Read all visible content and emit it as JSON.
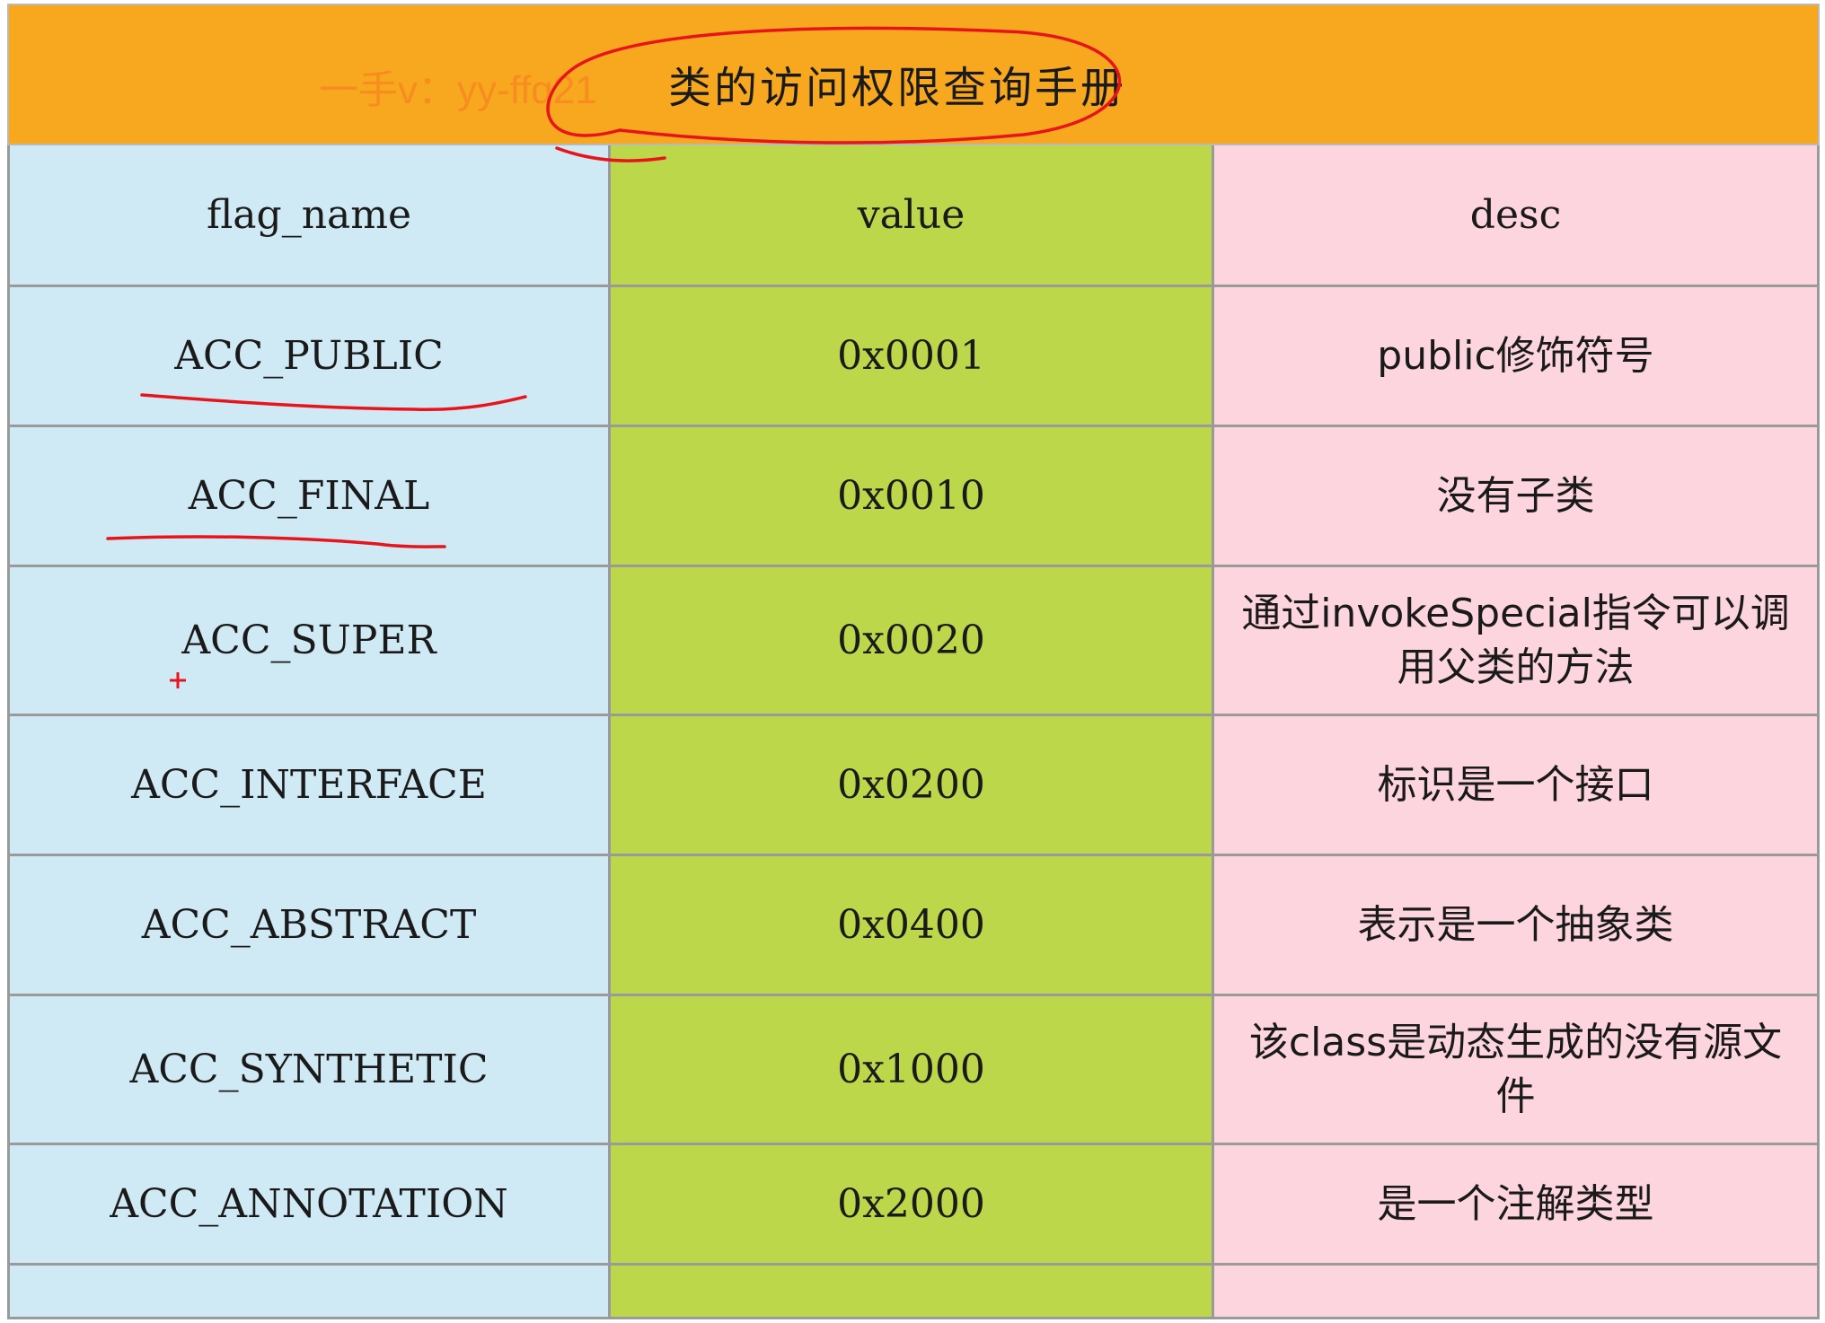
{
  "title": "类的访问权限查询手册",
  "watermark": "一手v：yy-ffq21",
  "columns": [
    "flag_name",
    "value",
    "desc"
  ],
  "rows": [
    {
      "flag_name": "ACC_PUBLIC",
      "value": "0x0001",
      "desc": "public修饰符号"
    },
    {
      "flag_name": "ACC_FINAL",
      "value": "0x0010",
      "desc": "没有子类"
    },
    {
      "flag_name": "ACC_SUPER",
      "value": "0x0020",
      "desc": "通过invokeSpecial指令可以调用父类的方法"
    },
    {
      "flag_name": "ACC_INTERFACE",
      "value": "0x0200",
      "desc": "标识是一个接口"
    },
    {
      "flag_name": "ACC_ABSTRACT",
      "value": "0x0400",
      "desc": "表示是一个抽象类"
    },
    {
      "flag_name": "ACC_SYNTHETIC",
      "value": "0x1000",
      "desc": "该class是动态生成的没有源文件"
    },
    {
      "flag_name": "ACC_ANNOTATION",
      "value": "0x2000",
      "desc": "是一个注解类型"
    }
  ],
  "colors": {
    "title_bg": "#f7a81f",
    "flag_col": "#cfeaf4",
    "value_col": "#bdd74a",
    "desc_col": "#fcd5df",
    "annotation": "#e8141b"
  }
}
